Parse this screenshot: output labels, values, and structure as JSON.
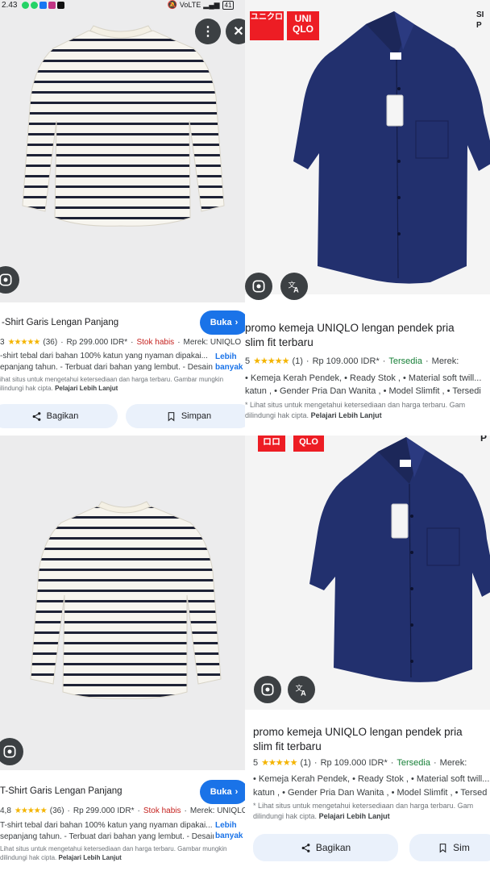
{
  "status_bar": {
    "time": "2.43",
    "network": "VoLTE",
    "battery": "41"
  },
  "colors": {
    "accent": "#1a73e8",
    "shirt": "#22306e",
    "uniqlo_red": "#ed1d24"
  },
  "icons": [
    "lens-icon",
    "translate-icon",
    "more-vert-icon",
    "close-icon",
    "share-icon",
    "bookmark-icon",
    "chevron-right-icon",
    "star-icon"
  ],
  "card_tl": {
    "title": "-Shirt Garis Lengan Panjang",
    "open_label": "Buka",
    "rating": "3",
    "stars": "★★★★★",
    "reviews": "(36)",
    "price": "Rp 299.000 IDR*",
    "stock": "Stok habis",
    "brand": "Merek: UNIQLO",
    "desc_line1": "-shirt tebal dari bahan 100% katun yang nyaman dipakai...",
    "desc_line2": "epanjang tahun. - Terbuat dari bahan yang lembut. - Desain",
    "more_label_1": "Lebih",
    "more_label_2": "banyak",
    "fine_line1": "ihat situs untuk mengetahui ketersediaan dan harga terbaru. Gambar mungkin",
    "fine_line2": "ilindungi hak cipta.",
    "learn_more": "Pelajari Lebih Lanjut",
    "share_label": "Bagikan",
    "save_label": "Simpan"
  },
  "card_tr": {
    "logo_top": "ユニクロ",
    "logo_left": "UNI",
    "logo_right": "QLO",
    "corner_text_1": "SI",
    "corner_text_2": "P",
    "title_line1": "promo kemeja UNIQLO lengan pendek pria",
    "title_line2": "slim fit terbaru",
    "rating": "5",
    "stars": "★★★★★",
    "reviews": "(1)",
    "price": "Rp 109.000 IDR*",
    "stock": "Tersedia",
    "brand": "Merek:",
    "desc_line1": "• Kemeja Kerah Pendek, • Ready Stok , • Material soft twill...",
    "desc_line2": "katun , • Gender Pria Dan Wanita , • Model Slimfit , • Tersedi",
    "fine_line1": "* Lihat situs untuk mengetahui ketersediaan dan harga terbaru. Gam",
    "fine_line2": "dilindungi hak cipta.",
    "learn_more": "Pelajari Lebih Lanjut"
  },
  "card_bl": {
    "title": "T-Shirt Garis Lengan Panjang",
    "open_label": "Buka",
    "rating": "4,8",
    "stars": "★★★★★",
    "reviews": "(36)",
    "price": "Rp 299.000 IDR*",
    "stock": "Stok habis",
    "brand": "Merek: UNIQLO",
    "desc_line1": "T-shirt tebal dari bahan 100% katun yang nyaman dipakai...",
    "desc_line2": "sepanjang tahun. - Terbuat dari bahan yang lembut. - Desain",
    "more_label_1": "Lebih",
    "more_label_2": "banyak",
    "fine_line1": "Lihat situs untuk mengetahui ketersediaan dan harga terbaru. Gambar mungkin",
    "fine_line2": "dilindungi hak cipta.",
    "learn_more": "Pelajari Lebih Lanjut"
  },
  "card_br": {
    "logo_left": "ロロ",
    "logo_right": "QLO",
    "corner_text": "P",
    "title_line1": "promo kemeja UNIQLO lengan pendek pria",
    "title_line2": "slim fit terbaru",
    "rating": "5",
    "stars": "★★★★★",
    "reviews": "(1)",
    "price": "Rp 109.000 IDR*",
    "stock": "Tersedia",
    "brand": "Merek:",
    "desc_line1": "• Kemeja Kerah Pendek, • Ready Stok , • Material soft twill...",
    "desc_line2": "katun , • Gender Pria Dan Wanita , • Model Slimfit , • Tersed",
    "fine_line1": "* Lihat situs untuk mengetahui ketersediaan dan harga terbaru. Gam",
    "fine_line2": "dilindungi hak cipta.",
    "learn_more": "Pelajari Lebih Lanjut",
    "share_label": "Bagikan",
    "save_label": "Sim"
  }
}
